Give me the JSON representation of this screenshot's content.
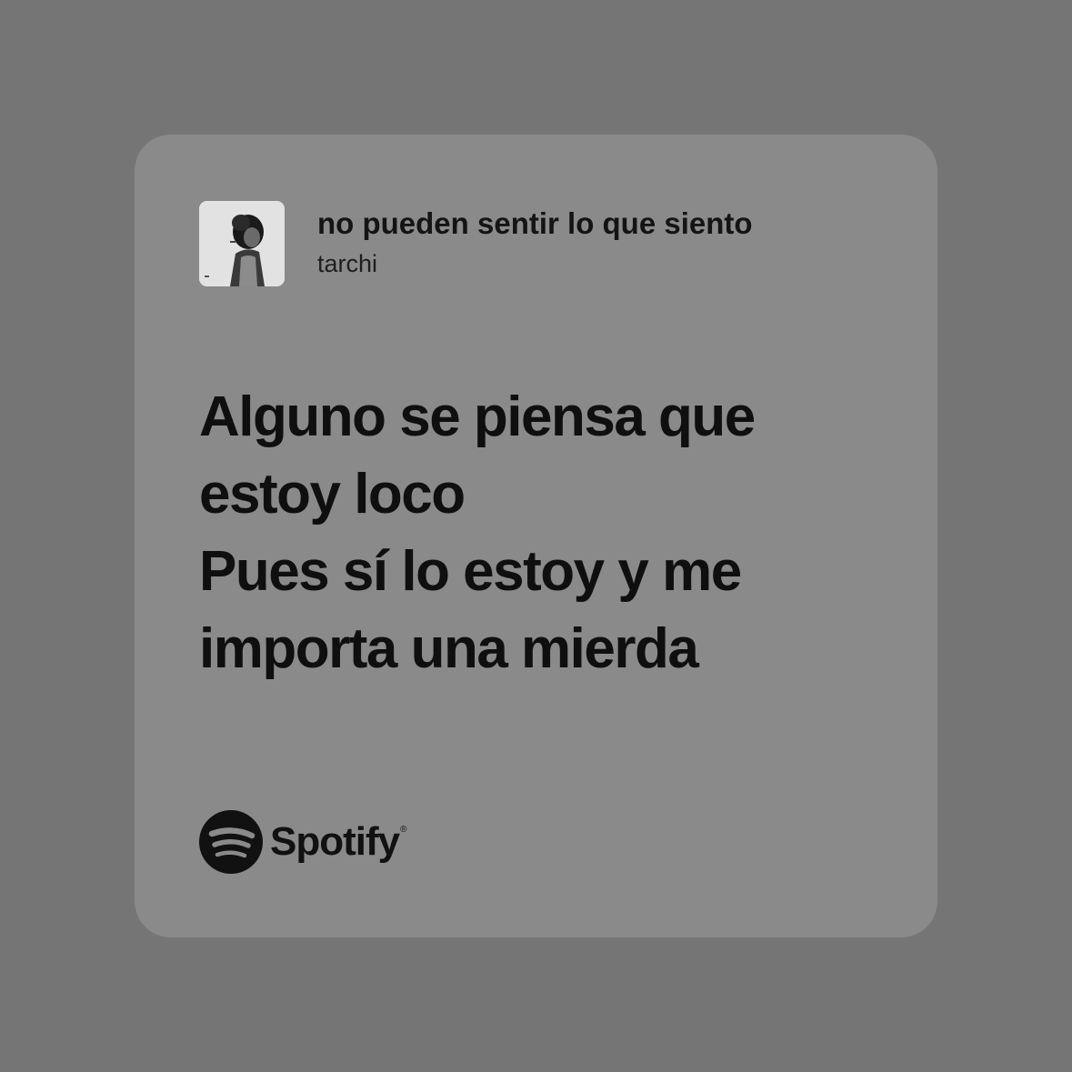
{
  "track": {
    "title": "no pueden sentir lo que siento",
    "artist": "tarchi"
  },
  "lyrics": [
    "Alguno se piensa que",
    "estoy loco",
    "Pues sí lo estoy y me",
    "importa una mierda"
  ],
  "brand": {
    "name": "Spotify",
    "registered_mark": "®",
    "icon": "spotify-logo-icon"
  },
  "colors": {
    "background": "#757575",
    "card": "#8a8a8a",
    "text": "#111111"
  }
}
